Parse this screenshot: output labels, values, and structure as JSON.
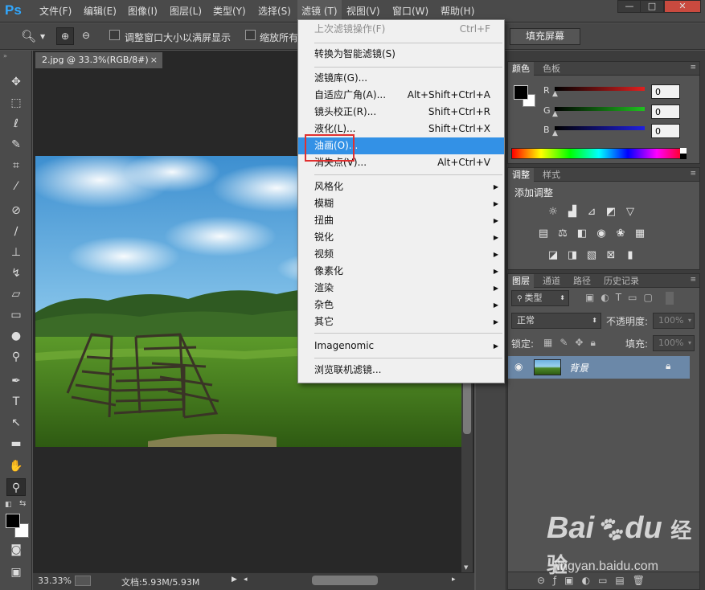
{
  "menubar": {
    "logo": "Ps",
    "items": [
      {
        "label": "文件(F)"
      },
      {
        "label": "编辑(E)"
      },
      {
        "label": "图像(I)"
      },
      {
        "label": "图层(L)"
      },
      {
        "label": "类型(Y)"
      },
      {
        "label": "选择(S)"
      },
      {
        "label": "滤镜 (T)"
      },
      {
        "label": "视图(V)"
      },
      {
        "label": "窗口(W)"
      },
      {
        "label": "帮助(H)"
      }
    ],
    "window_controls": [
      "—",
      "□",
      "✕"
    ]
  },
  "options_bar": {
    "checkbox1_label": "调整窗口大小以满屏显示",
    "checkbox2_label": "缩放所有",
    "fill_screen_button": "填充屏幕"
  },
  "document": {
    "tab_title": "2.jpg @ 33.3%(RGB/8#)",
    "tab_close": "×",
    "zoom": "33.33%",
    "doc_size": "文档:5.93M/5.93M"
  },
  "filter_menu": {
    "items": [
      {
        "label": "上次滤镜操作(F)",
        "shortcut": "Ctrl+F",
        "disabled": true
      },
      {
        "label": "转换为智能滤镜(S)"
      },
      {
        "label": "滤镜库(G)..."
      },
      {
        "label": "自适应广角(A)...",
        "shortcut": "Alt+Shift+Ctrl+A"
      },
      {
        "label": "镜头校正(R)...",
        "shortcut": "Shift+Ctrl+R"
      },
      {
        "label": "液化(L)...",
        "shortcut": "Shift+Ctrl+X"
      },
      {
        "label": "油画(O)...",
        "highlighted": true
      },
      {
        "label": "消失点(V)...",
        "shortcut": "Alt+Ctrl+V"
      },
      {
        "label": "风格化",
        "submenu": true
      },
      {
        "label": "模糊",
        "submenu": true
      },
      {
        "label": "扭曲",
        "submenu": true
      },
      {
        "label": "锐化",
        "submenu": true
      },
      {
        "label": "视频",
        "submenu": true
      },
      {
        "label": "像素化",
        "submenu": true
      },
      {
        "label": "渲染",
        "submenu": true
      },
      {
        "label": "杂色",
        "submenu": true
      },
      {
        "label": "其它",
        "submenu": true
      },
      {
        "label": "Imagenomic",
        "submenu": true
      },
      {
        "label": "浏览联机滤镜..."
      }
    ]
  },
  "color_panel": {
    "tabs": [
      "颜色",
      "色板"
    ],
    "channels": [
      {
        "label": "R",
        "value": "0",
        "color": "#e02020"
      },
      {
        "label": "G",
        "value": "0",
        "color": "#20c020"
      },
      {
        "label": "B",
        "value": "0",
        "color": "#2020e0"
      }
    ]
  },
  "adjust_panel": {
    "tabs": [
      "调整",
      "样式"
    ],
    "title": "添加调整"
  },
  "layers_panel": {
    "tabs": [
      "图层",
      "通道",
      "路径",
      "历史记录"
    ],
    "filter_kind": "类型",
    "blend_mode": "正常",
    "opacity_label": "不透明度:",
    "opacity_value": "100%",
    "lock_label": "锁定:",
    "fill_label": "填充:",
    "fill_value": "100%",
    "layers": [
      {
        "name": "背景",
        "visible": true,
        "locked": true
      }
    ]
  },
  "watermark": {
    "brand": "Bai",
    "brand2": "du",
    "suffix": "经验",
    "url": "jingyan.baidu.com"
  }
}
